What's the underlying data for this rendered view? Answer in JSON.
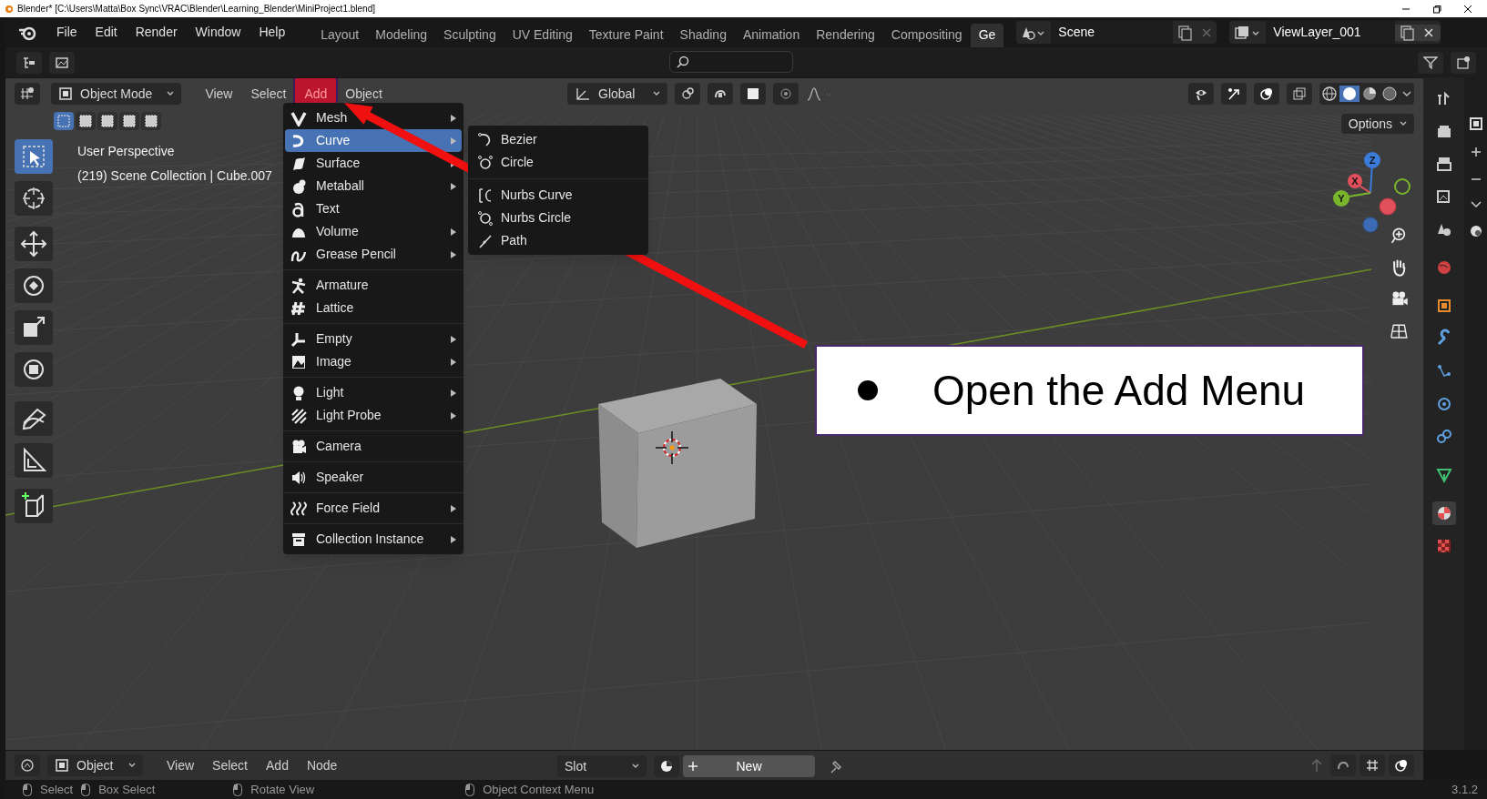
{
  "title_bar": {
    "title": "Blender* [C:\\Users\\Matta\\Box Sync\\VRAC\\Blender\\Learning_Blender\\MiniProject1.blend]"
  },
  "menu_bar": [
    "File",
    "Edit",
    "Render",
    "Window",
    "Help"
  ],
  "workspaces": [
    {
      "label": "Layout",
      "selected": false
    },
    {
      "label": "Modeling",
      "selected": false
    },
    {
      "label": "Sculpting",
      "selected": false
    },
    {
      "label": "UV Editing",
      "selected": false
    },
    {
      "label": "Texture Paint",
      "selected": false
    },
    {
      "label": "Shading",
      "selected": false
    },
    {
      "label": "Animation",
      "selected": false
    },
    {
      "label": "Rendering",
      "selected": false
    },
    {
      "label": "Compositing",
      "selected": false
    },
    {
      "label": "Ge",
      "selected": true
    }
  ],
  "scene": "Scene",
  "view_layer": "ViewLayer_001",
  "viewport_header": {
    "mode": "Object Mode",
    "menus": [
      {
        "label": "View",
        "selected": false
      },
      {
        "label": "Select",
        "selected": false
      },
      {
        "label": "Add",
        "selected": true
      },
      {
        "label": "Object",
        "selected": false
      }
    ],
    "orientation": "Global",
    "options": "Options"
  },
  "viewport_info": [
    "User Perspective",
    "(219) Scene Collection | Cube.007"
  ],
  "add_menu": {
    "groups": [
      [
        {
          "label": "Mesh",
          "submenu": true,
          "selected": false
        },
        {
          "label": "Curve",
          "submenu": true,
          "selected": true
        },
        {
          "label": "Surface",
          "submenu": true,
          "selected": false
        },
        {
          "label": "Metaball",
          "submenu": true,
          "selected": false
        },
        {
          "label": "Text",
          "submenu": false,
          "selected": false
        },
        {
          "label": "Volume",
          "submenu": true,
          "selected": false
        },
        {
          "label": "Grease Pencil",
          "submenu": true,
          "selected": false
        }
      ],
      [
        {
          "label": "Armature",
          "submenu": false,
          "selected": false
        },
        {
          "label": "Lattice",
          "submenu": false,
          "selected": false
        }
      ],
      [
        {
          "label": "Empty",
          "submenu": true,
          "selected": false
        },
        {
          "label": "Image",
          "submenu": true,
          "selected": false
        }
      ],
      [
        {
          "label": "Light",
          "submenu": true,
          "selected": false
        },
        {
          "label": "Light Probe",
          "submenu": true,
          "selected": false
        }
      ],
      [
        {
          "label": "Camera",
          "submenu": false,
          "selected": false
        }
      ],
      [
        {
          "label": "Speaker",
          "submenu": false,
          "selected": false
        }
      ],
      [
        {
          "label": "Force Field",
          "submenu": true,
          "selected": false
        }
      ],
      [
        {
          "label": "Collection Instance",
          "submenu": true,
          "selected": false
        }
      ]
    ]
  },
  "curve_submenu": {
    "groups": [
      [
        "Bezier",
        "Circle"
      ],
      [
        "Nurbs Curve",
        "Nurbs Circle",
        "Path"
      ]
    ]
  },
  "gizmo_axes": [
    "Z",
    "X",
    "Y"
  ],
  "callout": {
    "text": "Open the Add Menu"
  },
  "bottom_header": {
    "mode": "Object",
    "menus": [
      "View",
      "Select",
      "Add",
      "Node"
    ],
    "slot": "Slot",
    "new_button": "New"
  },
  "status_bar": {
    "items": [
      "Select",
      "Box Select",
      "Rotate View",
      "Object Context Menu"
    ],
    "version": "3.1.2"
  }
}
